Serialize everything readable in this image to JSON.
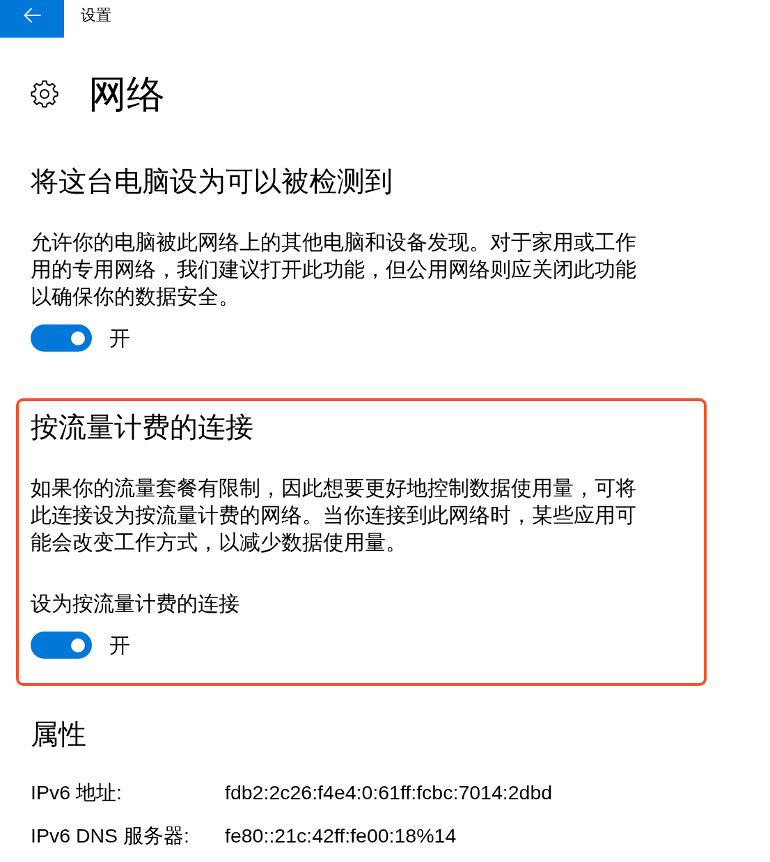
{
  "top_bar": {
    "title": "设置"
  },
  "header": {
    "title": "网络"
  },
  "sections": [
    {
      "kind": "setting",
      "heading": "将这台电脑设为可以被检测到",
      "description": "允许你的电脑被此网络上的其他电脑和设备发现。对于家用或工作用的专用网络，我们建议打开此功能，但公用网络则应关闭此功能以确保你的数据安全。",
      "highlighted": false,
      "toggle": {
        "on": true,
        "state_text": "开"
      }
    },
    {
      "kind": "setting",
      "heading": "按流量计费的连接",
      "description": "如果你的流量套餐有限制，因此想要更好地控制数据使用量，可将此连接设为按流量计费的网络。当你连接到此网络时，某些应用可能会改变工作方式，以减少数据使用量。",
      "highlighted": true,
      "toggle": {
        "label": "设为按流量计费的连接",
        "on": true,
        "state_text": "开"
      }
    },
    {
      "kind": "properties",
      "heading": "属性",
      "highlighted": false,
      "rows": [
        {
          "label": "IPv6 地址:",
          "value": "fdb2:2c26:f4e4:0:61ff:fcbc:7014:2dbd"
        },
        {
          "label": "IPv6 DNS 服务器:",
          "value": "fe80::21c:42ff:fe00:18%14"
        }
      ]
    }
  ]
}
